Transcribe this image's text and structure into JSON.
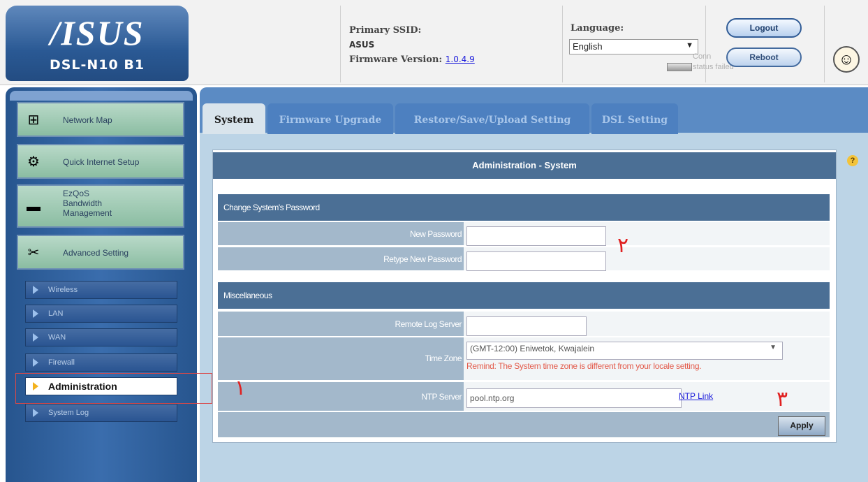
{
  "header": {
    "brand": "/ISUS",
    "model": "DSL-N10 B1",
    "ssid_label": "Primary SSID:",
    "ssid_value": "ASUS",
    "firmware_label": "Firmware Version:",
    "firmware_value": "1.0.4.9",
    "language_label": "Language:",
    "language_value": "English",
    "faded_text_1": "Conn",
    "faded_text_2": "status failed",
    "logout_label": "Logout",
    "reboot_label": "Reboot"
  },
  "sidebar": {
    "menu": [
      {
        "label": "Network Map",
        "icon": "network-map-icon"
      },
      {
        "label": "Quick Internet Setup",
        "icon": "quick-setup-icon"
      },
      {
        "label": "EzQoS\nBandwidth\nManagement",
        "icon": "qos-icon"
      },
      {
        "label": "Advanced Setting",
        "icon": "advanced-setting-icon"
      }
    ],
    "sub_items": [
      {
        "label": "Wireless"
      },
      {
        "label": "LAN"
      },
      {
        "label": "WAN"
      },
      {
        "label": "Firewall"
      },
      {
        "label": "Administration",
        "active": true
      },
      {
        "label": "System Log"
      }
    ]
  },
  "tabs": [
    {
      "label": "System",
      "active": true
    },
    {
      "label": "Firmware Upgrade"
    },
    {
      "label": "Restore/Save/Upload Setting"
    },
    {
      "label": "DSL Setting"
    }
  ],
  "page": {
    "title": "Administration - System",
    "password_section": "Change System's Password",
    "new_password_label": "New Password",
    "retype_password_label": "Retype New Password",
    "misc_section": "Miscellaneous",
    "remote_log_label": "Remote Log Server",
    "time_zone_label": "Time Zone",
    "time_zone_value": "(GMT-12:00) Eniwetok, Kwajalein",
    "time_zone_remind": "Remind: The System time zone is different from your locale setting.",
    "ntp_label": "NTP Server",
    "ntp_value": "pool.ntp.org",
    "ntp_link": "NTP Link",
    "apply_label": "Apply"
  },
  "annotations": {
    "num1": "۱",
    "num2": "۲",
    "num3": "۳",
    "color": "#e02020"
  },
  "colors": {
    "header_blue": "#2a5994",
    "sidebar_blue": "#27558e",
    "section_head": "#4b6f95",
    "row_bg": "#a3b8cb",
    "remind_red": "#e35b4b"
  }
}
